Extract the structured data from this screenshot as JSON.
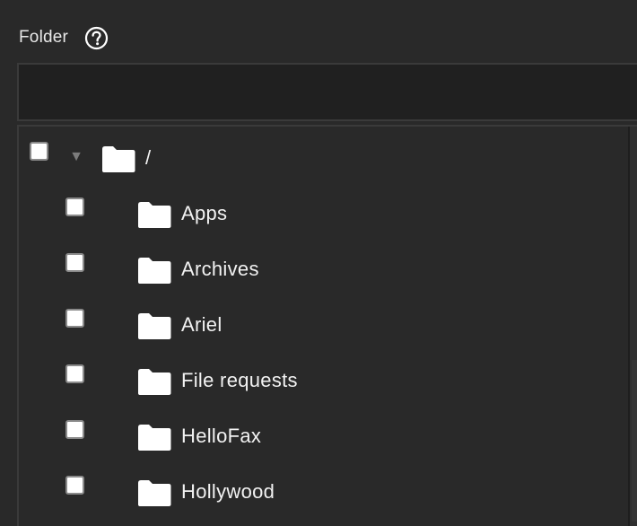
{
  "field": {
    "label": "Folder",
    "help_icon": "help-circle-icon",
    "input_value": ""
  },
  "tree": {
    "root": {
      "label": "/",
      "expanded": true,
      "checked": false,
      "icon": "folder-icon",
      "expander_icon": "triangle-down-icon",
      "expander_glyph": "▼"
    },
    "children": [
      {
        "label": "Apps",
        "checked": false,
        "icon": "folder-icon"
      },
      {
        "label": "Archives",
        "checked": false,
        "icon": "folder-icon"
      },
      {
        "label": "Ariel",
        "checked": false,
        "icon": "folder-icon"
      },
      {
        "label": "File requests",
        "checked": false,
        "icon": "folder-icon"
      },
      {
        "label": "HelloFax",
        "checked": false,
        "icon": "folder-icon"
      },
      {
        "label": "Hollywood",
        "checked": false,
        "icon": "folder-icon"
      }
    ]
  },
  "colors": {
    "background": "#292929",
    "input_background": "#202020",
    "border": "#3a3a3a",
    "text": "#ffffff",
    "expander": "#7c7c7c"
  }
}
